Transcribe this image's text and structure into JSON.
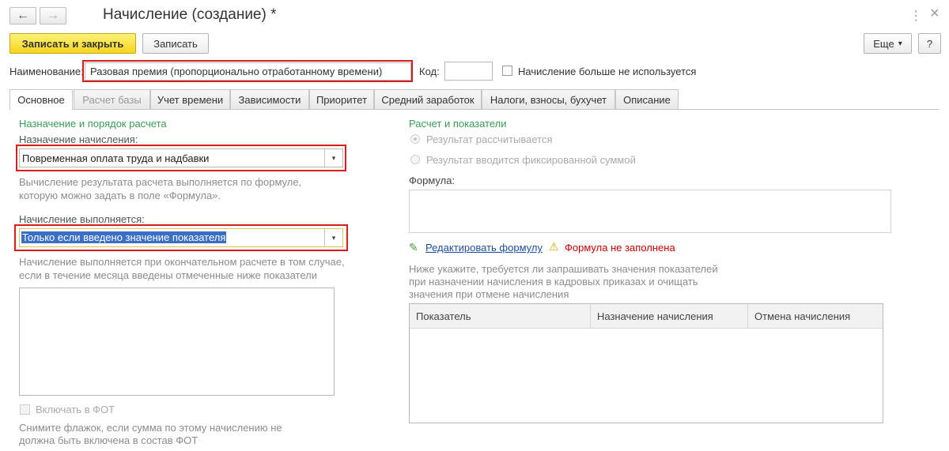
{
  "window": {
    "title": "Начисление (создание) *",
    "back_icon": "arrow-left-icon",
    "forward_icon": "arrow-right-icon",
    "more_icon": "⋮",
    "close_icon": "×"
  },
  "toolbar": {
    "save_close_label": "Записать и закрыть",
    "save_label": "Записать",
    "more_label": "Еще",
    "more_arrow": "▾",
    "help_label": "?"
  },
  "header": {
    "name_label": "Наименование:",
    "name_value": "Разовая премия (пропорционально отработанному времени)",
    "code_label": "Код:",
    "code_value": "",
    "not_used_label": "Начисление больше не используется"
  },
  "tabs": [
    {
      "label": "Основное"
    },
    {
      "label": "Расчет базы"
    },
    {
      "label": "Учет времени"
    },
    {
      "label": "Зависимости"
    },
    {
      "label": "Приоритет"
    },
    {
      "label": "Средний заработок"
    },
    {
      "label": "Налоги, взносы, бухучет"
    },
    {
      "label": "Описание"
    }
  ],
  "left": {
    "section_title": "Назначение и порядок расчета",
    "purpose_label": "Назначение начисления:",
    "purpose_value": "Повременная оплата труда и надбавки",
    "purpose_hint_1": "Вычисление результата расчета выполняется по формуле,",
    "purpose_hint_2": "которую можно задать в поле «Формула».",
    "executed_label": "Начисление выполняется:",
    "executed_value": "Только если введено значение показателя",
    "executed_hint_1": "Начисление выполняется при окончательном расчете в том случае,",
    "executed_hint_2": "если в течение месяца введены отмеченные ниже показатели",
    "fot_label": "Включать в ФОТ",
    "fot_hint_1": "Снимите флажок, если сумма по этому начислению не",
    "fot_hint_2": "должна быть включена в состав ФОТ"
  },
  "right": {
    "section_title": "Расчет и показатели",
    "radio_calculated": "Результат рассчитывается",
    "radio_fixed": "Результат вводится фиксированной суммой",
    "formula_label": "Формула:",
    "formula_value": "",
    "edit_formula_link": "Редактировать формулу",
    "warning_text": "Формула не заполнена",
    "indicators_hint_1": "Ниже укажите, требуется ли запрашивать значения показателей",
    "indicators_hint_2": "при назначении начисления в кадровых приказах и очищать",
    "indicators_hint_3": "значения при отмене начисления",
    "table_headers": [
      "Показатель",
      "Назначение начисления",
      "Отмена начисления"
    ]
  },
  "colors": {
    "accent_yellow": "#f6d41c",
    "highlight_red": "#d61e1e",
    "section_green": "#3a9a55",
    "link_blue": "#1f4e9c",
    "warning_red": "#c00000",
    "selection_blue": "#3b6fc4"
  }
}
